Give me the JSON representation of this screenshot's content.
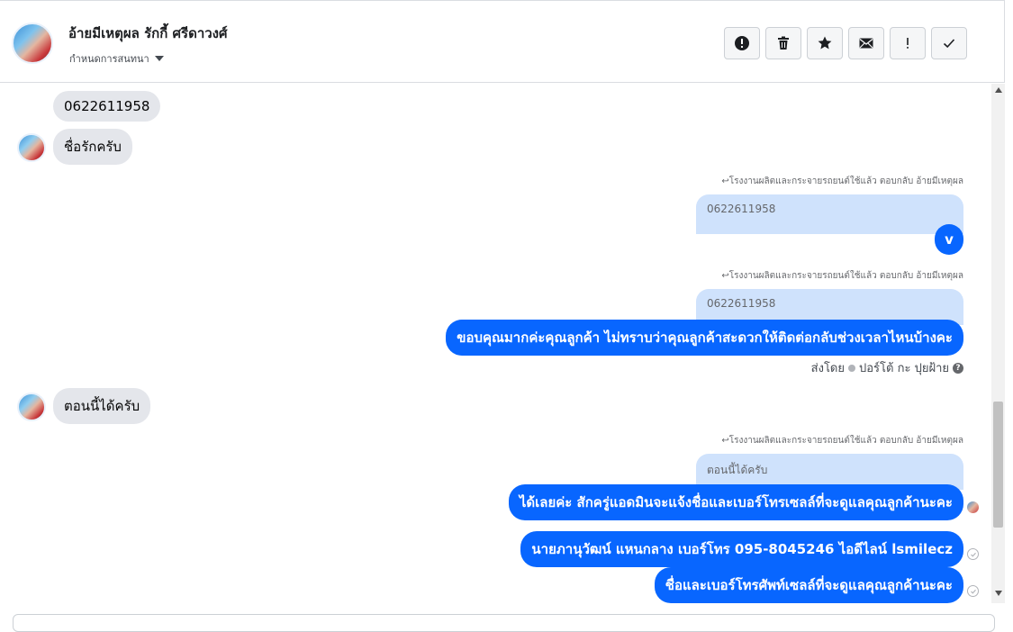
{
  "header": {
    "contact_name": "อ้ายมีเหตุผล รักกี้ ศรีดาวงศ์",
    "assign_label": "กำหนดการสนทนา",
    "toolbar": [
      {
        "name": "report-spam-button",
        "icon": "alert-circle-icon"
      },
      {
        "name": "delete-button",
        "icon": "trash-icon"
      },
      {
        "name": "star-button",
        "icon": "star-icon"
      },
      {
        "name": "mark-unread-button",
        "icon": "envelope-icon"
      },
      {
        "name": "flag-button",
        "icon": "exclamation-icon"
      },
      {
        "name": "mark-done-button",
        "icon": "checkmark-icon"
      }
    ]
  },
  "messages": {
    "in1": "0622611958",
    "in2": "ชื่อรักครับ",
    "reply1_meta": "โรงงานผลิตและกระจายรถยนต์ใช้แล้ว ตอบกลับ อ้ายมีเหตุผล",
    "reply1_quote": "0622611958",
    "out1": "v",
    "reply2_meta": "โรงงานผลิตและกระจายรถยนต์ใช้แล้ว ตอบกลับ อ้ายมีเหตุผล",
    "reply2_quote": "0622611958",
    "out2": "ขอบคุณมากค่ะคุณลูกค้า ไม่ทราบว่าคุณลูกค้าสะดวกให้ติดต่อกลับช่วงเวลาไหนบ้างคะ",
    "sent_by_label": "ส่งโดย",
    "sent_by_name": "ปอร์โต้ กะ ปุยฝ้าย",
    "in3": "ตอนนี้ได้ครับ",
    "reply3_meta": "โรงงานผลิตและกระจายรถยนต์ใช้แล้ว ตอบกลับ อ้ายมีเหตุผล",
    "reply3_quote": "ตอนนี้ได้ครับ",
    "out3": "ได้เลยค่ะ สักครู่แอดมินจะแจ้งชื่อและเบอร์โทรเซลล์ที่จะดูแลคุณลูกค้านะคะ",
    "out4": "นายภานุวัฒน์ แหนกลาง เบอร์โทร 095-8045246 ไอดีไลน์ lsmilecz",
    "out5": "ชื่อและเบอร์โทรศัพท์เซลล์ที่จะดูแลคุณลูกค้านะคะ"
  }
}
